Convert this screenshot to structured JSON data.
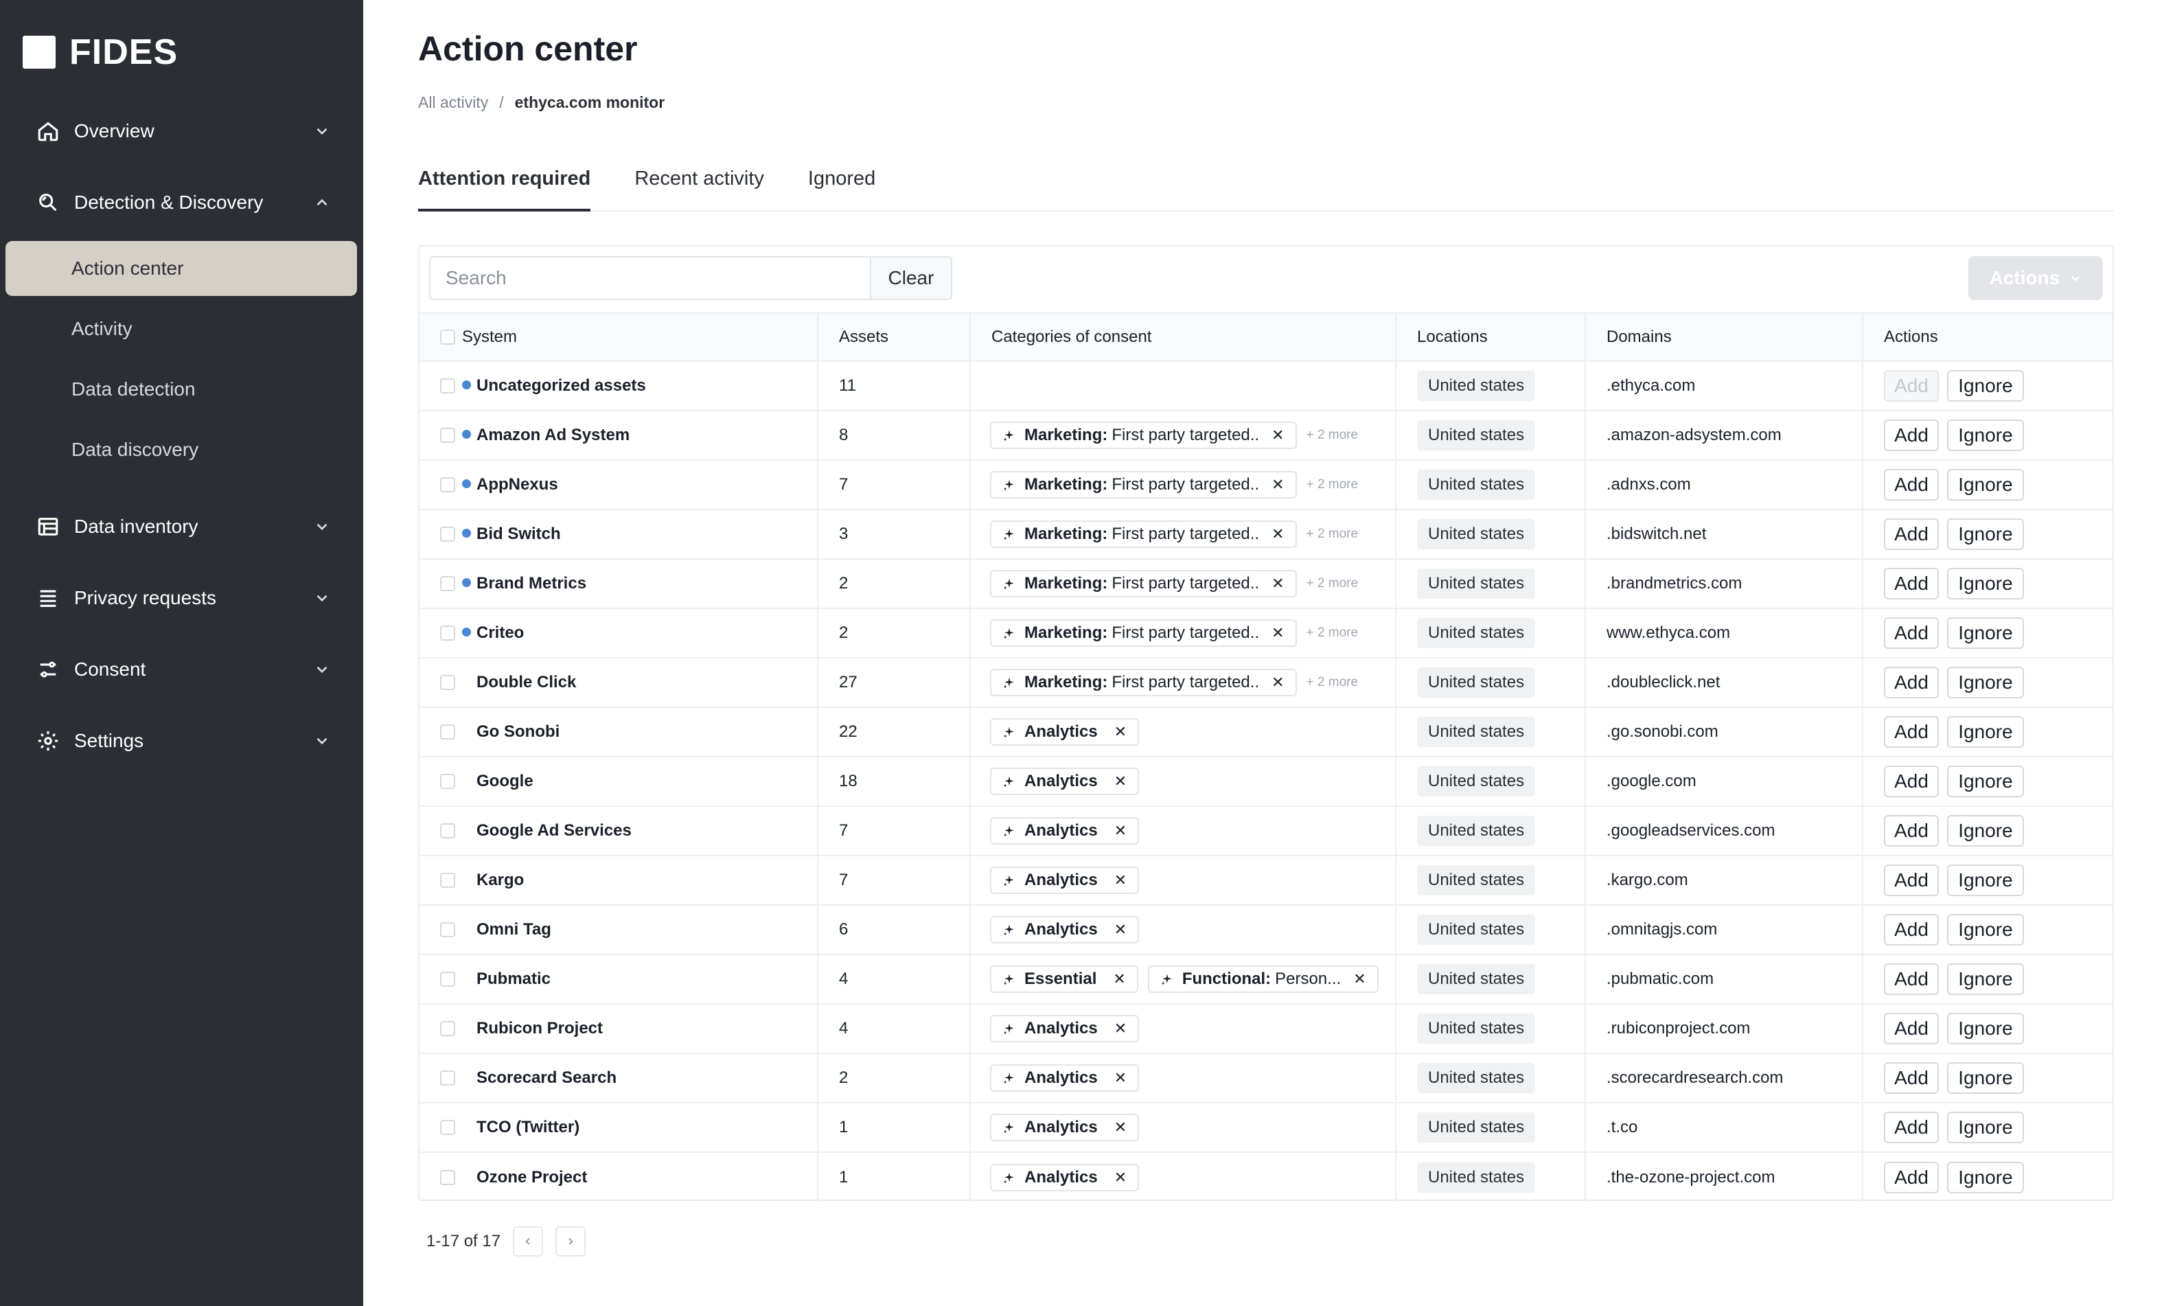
{
  "app": {
    "name": "FIDES"
  },
  "sidebar": {
    "overview": "Overview",
    "detection": "Detection & Discovery",
    "sub_items": [
      "Action center",
      "Activity",
      "Data detection",
      "Data discovery"
    ],
    "data_inventory": "Data inventory",
    "privacy_requests": "Privacy requests",
    "consent": "Consent",
    "settings": "Settings"
  },
  "page": {
    "title": "Action center"
  },
  "breadcrumb": {
    "root": "All activity",
    "sep": "/",
    "current": "ethyca.com monitor"
  },
  "tabs": [
    "Attention required",
    "Recent activity",
    "Ignored"
  ],
  "toolbar": {
    "search_placeholder": "Search",
    "clear_label": "Clear",
    "actions_label": "Actions"
  },
  "table": {
    "columns": [
      "System",
      "Assets",
      "Categories of consent",
      "Locations",
      "Domains",
      "Actions"
    ],
    "add_label": "Add",
    "ignore_label": "Ignore",
    "rows": [
      {
        "system": "Uncategorized assets",
        "dot": true,
        "assets": "11",
        "tags": [],
        "more": "",
        "location": "United states",
        "domain": ".ethyca.com",
        "add_disabled": true
      },
      {
        "system": "Amazon Ad System",
        "dot": true,
        "assets": "8",
        "tags": [
          {
            "bold": "Marketing:",
            "text": "First party targeted.."
          }
        ],
        "more": "+ 2 more",
        "location": "United states",
        "domain": ".amazon-adsystem.com",
        "add_disabled": false
      },
      {
        "system": "AppNexus",
        "dot": true,
        "assets": "7",
        "tags": [
          {
            "bold": "Marketing:",
            "text": "First party targeted.."
          }
        ],
        "more": "+ 2 more",
        "location": "United states",
        "domain": ".adnxs.com",
        "add_disabled": false
      },
      {
        "system": "Bid Switch",
        "dot": true,
        "assets": "3",
        "tags": [
          {
            "bold": "Marketing:",
            "text": "First party targeted.."
          }
        ],
        "more": "+ 2 more",
        "location": "United states",
        "domain": ".bidswitch.net",
        "add_disabled": false
      },
      {
        "system": "Brand Metrics",
        "dot": true,
        "assets": "2",
        "tags": [
          {
            "bold": "Marketing:",
            "text": "First party targeted.."
          }
        ],
        "more": "+ 2 more",
        "location": "United states",
        "domain": ".brandmetrics.com",
        "add_disabled": false
      },
      {
        "system": "Criteo",
        "dot": true,
        "assets": "2",
        "tags": [
          {
            "bold": "Marketing:",
            "text": "First party targeted.."
          }
        ],
        "more": "+ 2 more",
        "location": "United states",
        "domain": "www.ethyca.com",
        "add_disabled": false
      },
      {
        "system": "Double Click",
        "dot": false,
        "assets": "27",
        "tags": [
          {
            "bold": "Marketing:",
            "text": "First party targeted.."
          }
        ],
        "more": "+ 2 more",
        "location": "United states",
        "domain": ".doubleclick.net",
        "add_disabled": false
      },
      {
        "system": "Go Sonobi",
        "dot": false,
        "assets": "22",
        "tags": [
          {
            "bold": "Analytics",
            "text": ""
          }
        ],
        "more": "",
        "location": "United states",
        "domain": ".go.sonobi.com",
        "add_disabled": false
      },
      {
        "system": "Google",
        "dot": false,
        "assets": "18",
        "tags": [
          {
            "bold": "Analytics",
            "text": ""
          }
        ],
        "more": "",
        "location": "United states",
        "domain": ".google.com",
        "add_disabled": false
      },
      {
        "system": "Google Ad Services",
        "dot": false,
        "assets": "7",
        "tags": [
          {
            "bold": "Analytics",
            "text": ""
          }
        ],
        "more": "",
        "location": "United states",
        "domain": ".googleadservices.com",
        "add_disabled": false
      },
      {
        "system": "Kargo",
        "dot": false,
        "assets": "7",
        "tags": [
          {
            "bold": "Analytics",
            "text": ""
          }
        ],
        "more": "",
        "location": "United states",
        "domain": ".kargo.com",
        "add_disabled": false
      },
      {
        "system": "Omni Tag",
        "dot": false,
        "assets": "6",
        "tags": [
          {
            "bold": "Analytics",
            "text": ""
          }
        ],
        "more": "",
        "location": "United states",
        "domain": ".omnitagjs.com",
        "add_disabled": false
      },
      {
        "system": "Pubmatic",
        "dot": false,
        "assets": "4",
        "tags": [
          {
            "bold": "Essential",
            "text": ""
          },
          {
            "bold": "Functional:",
            "text": "Person..."
          }
        ],
        "more": "",
        "location": "United states",
        "domain": ".pubmatic.com",
        "add_disabled": false
      },
      {
        "system": "Rubicon Project",
        "dot": false,
        "assets": "4",
        "tags": [
          {
            "bold": "Analytics",
            "text": ""
          }
        ],
        "more": "",
        "location": "United states",
        "domain": ".rubiconproject.com",
        "add_disabled": false
      },
      {
        "system": "Scorecard Search",
        "dot": false,
        "assets": "2",
        "tags": [
          {
            "bold": "Analytics",
            "text": ""
          }
        ],
        "more": "",
        "location": "United states",
        "domain": ".scorecardresearch.com",
        "add_disabled": false
      },
      {
        "system": "TCO (Twitter)",
        "dot": false,
        "assets": "1",
        "tags": [
          {
            "bold": "Analytics",
            "text": ""
          }
        ],
        "more": "",
        "location": "United states",
        "domain": ".t.co",
        "add_disabled": false
      },
      {
        "system": "Ozone Project",
        "dot": false,
        "assets": "1",
        "tags": [
          {
            "bold": "Analytics",
            "text": ""
          }
        ],
        "more": "",
        "location": "United states",
        "domain": ".the-ozone-project.com",
        "add_disabled": false
      }
    ]
  },
  "pagination": {
    "summary": "1-17 of 17"
  },
  "colors": {
    "sidebar_bg": "#2b2e35",
    "active_item_bg": "#d4d0c8",
    "dot_blue": "#4b86d6"
  }
}
